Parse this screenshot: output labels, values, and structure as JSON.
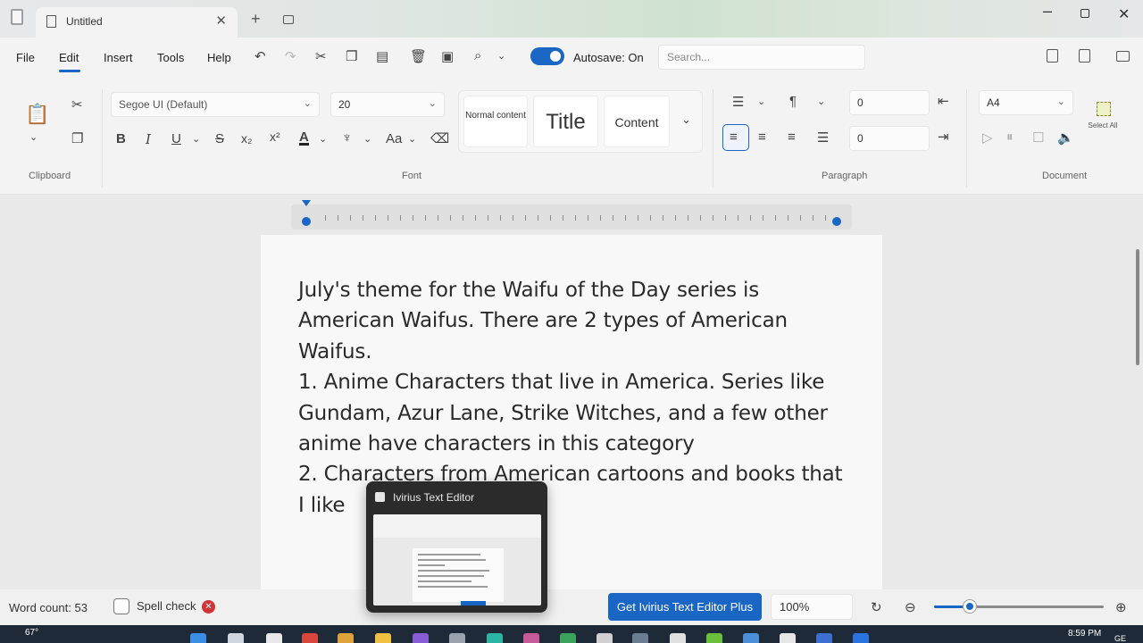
{
  "tab": {
    "title": "Untitled",
    "close_glyph": "✕",
    "new_glyph": "+"
  },
  "menu": {
    "file": "File",
    "edit": "Edit",
    "insert": "Insert",
    "tools": "Tools",
    "help": "Help"
  },
  "toolbar": {
    "autosave_label": "Autosave: On",
    "search_placeholder": "Search..."
  },
  "ribbon": {
    "clipboard_label": "Clipboard",
    "font_label": "Font",
    "paragraph_label": "Paragraph",
    "document_label": "Document",
    "font_family": "Segoe UI (Default)",
    "font_size": "20",
    "style_normal": "Normal content",
    "style_title": "Title",
    "style_content": "Content",
    "indent_value": "0",
    "spacing_value": "0",
    "page_size": "A4",
    "select_all": "Select All"
  },
  "document": {
    "lines": [
      "July's theme for the Waifu of the Day series is",
      "American Waifus. There are 2 types of American",
      "Waifus.",
      "1. Anime Characters that live in America. Series like",
      "Gundam, Azur Lane, Strike Witches, and a few other",
      "anime have characters in this category",
      "2. Characters from American cartoons and books that",
      "I like"
    ]
  },
  "status": {
    "word_count": "Word count: 53",
    "spell_check": "Spell check",
    "plus_button": "Get Ivirius Text Editor Plus",
    "zoom": "100%",
    "zoom_level": 0.2
  },
  "preview": {
    "title": "Ivirius Text Editor"
  },
  "taskbar": {
    "temperature": "67°",
    "time": "8:59 PM",
    "language": "GE"
  },
  "colors": {
    "accent": "#1a66c4",
    "error": "#d13438",
    "taskbar": "#1f2a38"
  },
  "icons": [
    "undo-icon",
    "redo-icon",
    "cut-icon",
    "copy-icon",
    "paste-icon",
    "delete-icon",
    "save-icon",
    "search-icon",
    "bold-icon",
    "italic-icon",
    "underline-icon",
    "strikethrough-icon",
    "subscript-icon",
    "superscript-icon",
    "font-color-icon",
    "highlight-icon",
    "text-size-icon",
    "clear-format-icon",
    "list-icon",
    "paragraph-icon",
    "align-left-icon",
    "align-center-icon",
    "align-right-icon",
    "justify-icon"
  ]
}
